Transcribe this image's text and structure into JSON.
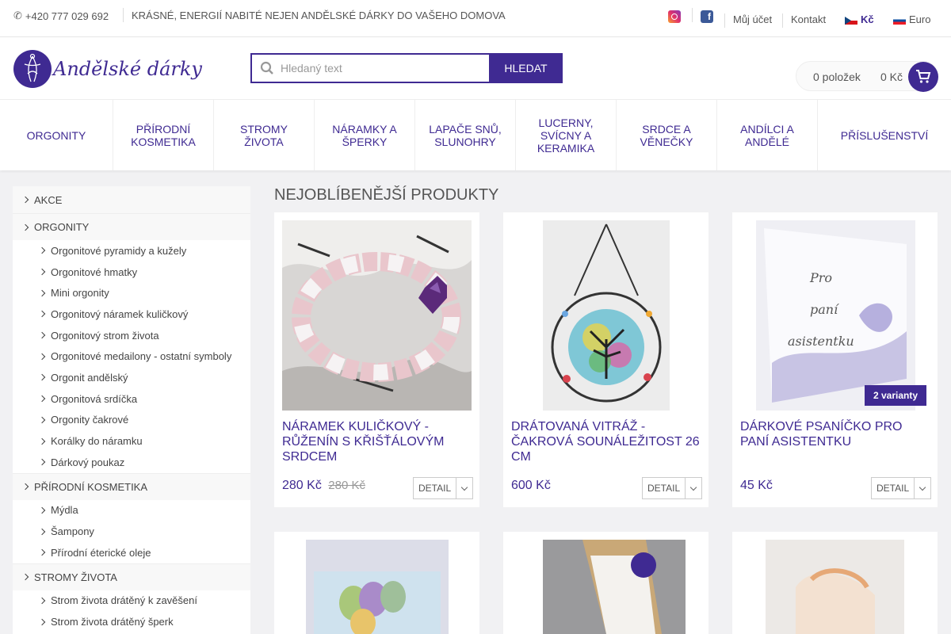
{
  "topbar": {
    "phone": "+420 777 029 692",
    "motto": "KRÁSNÉ, ENERGIÍ NABITÉ NEJEN ANDĚLSKÉ DÁRKY DO VAŠEHO DOMOVA",
    "facebook": "f",
    "account": "Můj účet",
    "contact": "Kontakt",
    "currency_czk": "Kč",
    "currency_eur": "Euro"
  },
  "header": {
    "logo_text": "Andělské dárky",
    "search_placeholder": "Hledaný text",
    "search_button": "HLEDAT",
    "cart_items": "0 položek",
    "cart_price": "0 Kč"
  },
  "nav": [
    "ORGONITY",
    "PŘÍRODNÍ KOSMETIKA",
    "STROMY ŽIVOTA",
    "NÁRAMKY A ŠPERKY",
    "LAPAČE SNŮ, SLUNOHRY",
    "LUCERNY, SVÍCNY A KERAMIKA",
    "SRDCE A VĚNEČKY",
    "ANDÍLCI A ANDĚLÉ",
    "PŘÍSLUŠENSTVÍ"
  ],
  "sidebar": {
    "akce": "AKCE",
    "orgonity": "ORGONITY",
    "orgonity_items": [
      "Orgonitové pyramidy a kužely",
      "Orgonitové hmatky",
      "Mini orgonity",
      "Orgonitový náramek kuličkový",
      "Orgonitový strom života",
      "Orgonitové medailony - ostatní symboly",
      "Orgonit andělský",
      "Orgonitová srdíčka",
      "Orgonity čakrové",
      "Korálky do náramku",
      "Dárkový poukaz"
    ],
    "kosmetika": "PŘÍRODNÍ KOSMETIKA",
    "kosmetika_items": [
      "Mýdla",
      "Šampony",
      "Přírodní éterické oleje"
    ],
    "stromy": "STROMY ŽIVOTA",
    "stromy_items": [
      "Strom života drátěný k zavěšení",
      "Strom života drátěný šperk"
    ]
  },
  "main": {
    "title": "NEJOBLÍBENĚJŠÍ PRODUKTY",
    "detail_label": "DETAIL",
    "products": [
      {
        "name": "NÁRAMEK KULIČKOVÝ - RŮŽENÍN S KŘIŠŤÁLOVÝM SRDCEM",
        "price": "280 Kč",
        "old_price": "280 Kč"
      },
      {
        "name": "DRÁTOVANÁ VITRÁŽ - ČAKROVÁ SOUNÁLEŽITOST 26 CM",
        "price": "600 Kč"
      },
      {
        "name": "DÁRKOVÉ PSANÍČKO PRO PANÍ ASISTENTKU",
        "price": "45 Kč",
        "badge": "2 varianty",
        "image_text": [
          "Pro",
          "paní",
          "asistentku"
        ]
      }
    ]
  },
  "colors": {
    "brand": "#3f2a92"
  }
}
